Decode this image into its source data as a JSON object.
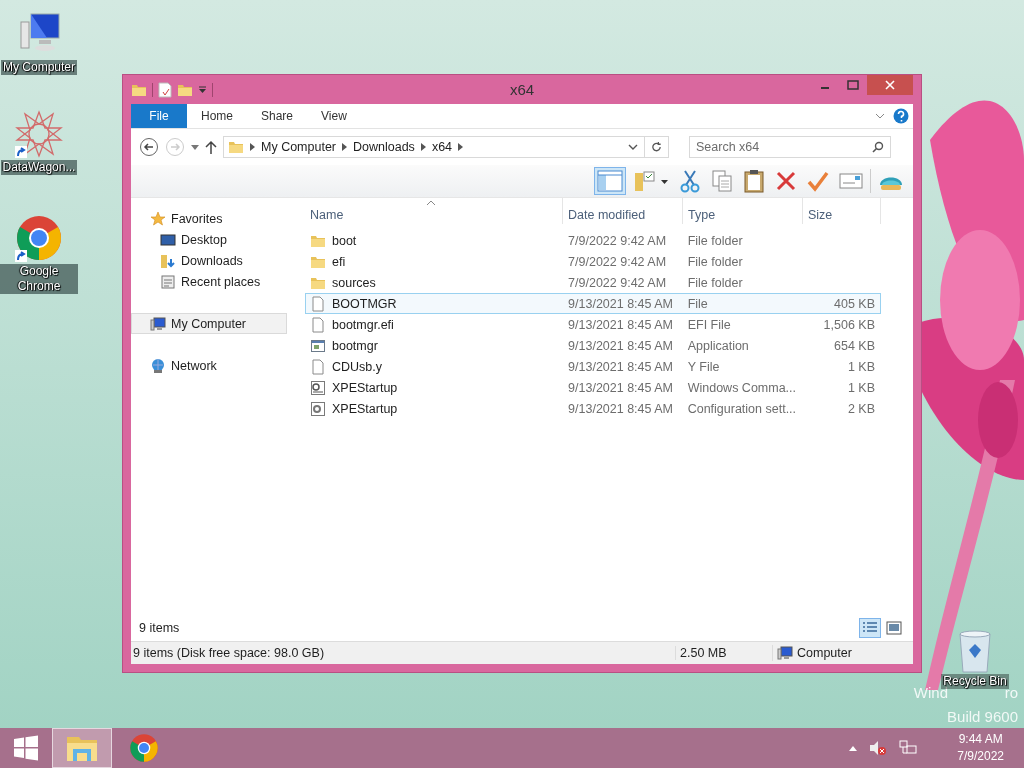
{
  "desktop_icons": [
    {
      "label": "My Computer",
      "kind": "computer",
      "shortcut": false
    },
    {
      "label": "DataWagon...",
      "kind": "star",
      "shortcut": true
    },
    {
      "label": "Google Chrome",
      "kind": "chrome",
      "shortcut": true
    }
  ],
  "window": {
    "title": "x64"
  },
  "ribbon_tabs": [
    {
      "label": "File",
      "selected": true
    },
    {
      "label": "Home",
      "selected": false
    },
    {
      "label": "Share",
      "selected": false
    },
    {
      "label": "View",
      "selected": false
    }
  ],
  "address": {
    "path": [
      "My Computer",
      "Downloads",
      "x64"
    ]
  },
  "search": {
    "placeholder": "Search x64"
  },
  "nav": [
    {
      "label": "Favorites",
      "kind": "star",
      "selected": false,
      "children": [
        {
          "label": "Desktop",
          "kind": "desktop",
          "selected": false
        },
        {
          "label": "Downloads",
          "kind": "downloads",
          "selected": false
        },
        {
          "label": "Recent places",
          "kind": "recent",
          "selected": false
        }
      ]
    },
    {
      "label": "My Computer",
      "kind": "computer",
      "selected": true
    },
    {
      "label": "Network",
      "kind": "network",
      "selected": false
    }
  ],
  "table": {
    "columns": [
      "Name",
      "Date modified",
      "Type",
      "Size"
    ],
    "rows": [
      {
        "name": "boot",
        "date": "7/9/2022 9:42 AM",
        "type": "File folder",
        "kind": "folder",
        "selected": false
      },
      {
        "name": "efi",
        "date": "7/9/2022 9:42 AM",
        "type": "File folder",
        "kind": "folder",
        "selected": false
      },
      {
        "name": "sources",
        "date": "7/9/2022 9:42 AM",
        "type": "File folder",
        "kind": "folder",
        "selected": false
      },
      {
        "name": "BOOTMGR",
        "date": "9/13/2021 8:45 AM",
        "type": "File",
        "size": "405 KB",
        "kind": "file",
        "selected": true
      },
      {
        "name": "bootmgr.efi",
        "date": "9/13/2021 8:45 AM",
        "type": "EFI File",
        "size": "1,506 KB",
        "kind": "file",
        "selected": false
      },
      {
        "name": "bootmgr",
        "date": "9/13/2021 8:45 AM",
        "type": "Application",
        "size": "654 KB",
        "kind": "app",
        "selected": false
      },
      {
        "name": "CDUsb.y",
        "date": "9/13/2021 8:45 AM",
        "type": "Y File",
        "size": "1 KB",
        "kind": "file",
        "selected": false
      },
      {
        "name": "XPEStartup",
        "date": "9/13/2021 8:45 AM",
        "type": "Windows Comma...",
        "size": "1 KB",
        "kind": "script",
        "selected": false
      },
      {
        "name": "XPEStartup",
        "date": "9/13/2021 8:45 AM",
        "type": "Configuration sett...",
        "size": "2 KB",
        "kind": "config",
        "selected": false
      }
    ]
  },
  "item_count": "9 items",
  "view_buttons": [
    {
      "kind": "details",
      "selected": true
    },
    {
      "kind": "thumbnails",
      "selected": false
    }
  ],
  "status_bar": {
    "summary": "9 items (Disk free space: 98.0 GB)",
    "size": "2.50 MB",
    "location": "Computer"
  },
  "recycle_bin": {
    "label": "Recycle Bin"
  },
  "os_watermark": {
    "line_1_parts": [
      "Wind",
      "ro"
    ],
    "line_2": "Build 9600"
  },
  "taskbar": {
    "apps": [
      {
        "kind": "explorer",
        "selected": true
      },
      {
        "kind": "chrome",
        "selected": false
      }
    ],
    "time": "9:44 AM",
    "date": "7/9/2022"
  }
}
